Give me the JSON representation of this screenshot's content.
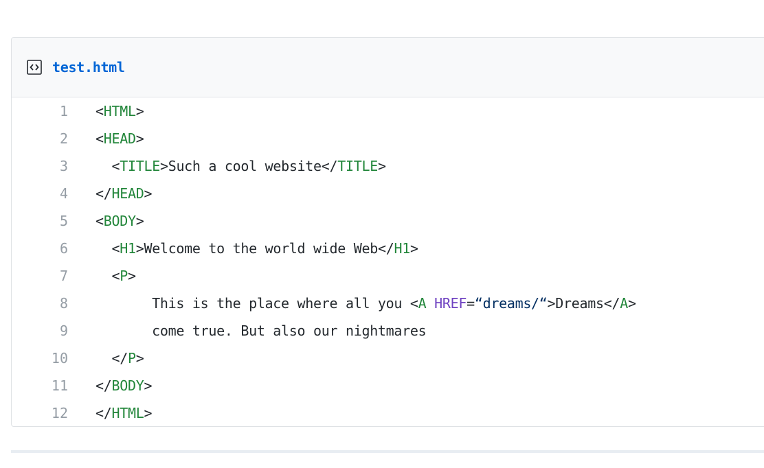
{
  "file": {
    "name": "test.html",
    "icon": "file-code-icon"
  },
  "colors": {
    "tag": "#22863a",
    "attribute": "#6f42c1",
    "string": "#032f62",
    "text": "#24292e",
    "link": "#0366d6",
    "line_number": "#959da5"
  },
  "lines": [
    {
      "number": "1",
      "tokens": [
        {
          "type": "punc",
          "text": "<"
        },
        {
          "type": "tag",
          "text": "HTML"
        },
        {
          "type": "punc",
          "text": ">"
        }
      ]
    },
    {
      "number": "2",
      "tokens": [
        {
          "type": "punc",
          "text": "<"
        },
        {
          "type": "tag",
          "text": "HEAD"
        },
        {
          "type": "punc",
          "text": ">"
        }
      ]
    },
    {
      "number": "3",
      "tokens": [
        {
          "type": "text",
          "text": "  "
        },
        {
          "type": "punc",
          "text": "<"
        },
        {
          "type": "tag",
          "text": "TITLE"
        },
        {
          "type": "punc",
          "text": ">"
        },
        {
          "type": "text",
          "text": "Such a cool website"
        },
        {
          "type": "punc",
          "text": "</"
        },
        {
          "type": "tag",
          "text": "TITLE"
        },
        {
          "type": "punc",
          "text": ">"
        }
      ]
    },
    {
      "number": "4",
      "tokens": [
        {
          "type": "punc",
          "text": "</"
        },
        {
          "type": "tag",
          "text": "HEAD"
        },
        {
          "type": "punc",
          "text": ">"
        }
      ]
    },
    {
      "number": "5",
      "tokens": [
        {
          "type": "punc",
          "text": "<"
        },
        {
          "type": "tag",
          "text": "BODY"
        },
        {
          "type": "punc",
          "text": ">"
        }
      ]
    },
    {
      "number": "6",
      "tokens": [
        {
          "type": "text",
          "text": "  "
        },
        {
          "type": "punc",
          "text": "<"
        },
        {
          "type": "tag",
          "text": "H1"
        },
        {
          "type": "punc",
          "text": ">"
        },
        {
          "type": "text",
          "text": "Welcome to the world wide Web"
        },
        {
          "type": "punc",
          "text": "</"
        },
        {
          "type": "tag",
          "text": "H1"
        },
        {
          "type": "punc",
          "text": ">"
        }
      ]
    },
    {
      "number": "7",
      "tokens": [
        {
          "type": "text",
          "text": "  "
        },
        {
          "type": "punc",
          "text": "<"
        },
        {
          "type": "tag",
          "text": "P"
        },
        {
          "type": "punc",
          "text": ">"
        }
      ]
    },
    {
      "number": "8",
      "tokens": [
        {
          "type": "text",
          "text": "       This is the place where all you "
        },
        {
          "type": "punc",
          "text": "<"
        },
        {
          "type": "tag",
          "text": "A"
        },
        {
          "type": "text",
          "text": " "
        },
        {
          "type": "attr",
          "text": "HREF"
        },
        {
          "type": "punc",
          "text": "="
        },
        {
          "type": "str",
          "text": "“dreams/“"
        },
        {
          "type": "punc",
          "text": ">"
        },
        {
          "type": "text",
          "text": "Dreams"
        },
        {
          "type": "punc",
          "text": "</"
        },
        {
          "type": "tag",
          "text": "A"
        },
        {
          "type": "punc",
          "text": ">"
        }
      ]
    },
    {
      "number": "9",
      "tokens": [
        {
          "type": "text",
          "text": "       come true. But also our nightmares"
        }
      ]
    },
    {
      "number": "10",
      "tokens": [
        {
          "type": "text",
          "text": "  "
        },
        {
          "type": "punc",
          "text": "</"
        },
        {
          "type": "tag",
          "text": "P"
        },
        {
          "type": "punc",
          "text": ">"
        }
      ]
    },
    {
      "number": "11",
      "tokens": [
        {
          "type": "punc",
          "text": "</"
        },
        {
          "type": "tag",
          "text": "BODY"
        },
        {
          "type": "punc",
          "text": ">"
        }
      ]
    },
    {
      "number": "12",
      "tokens": [
        {
          "type": "punc",
          "text": "</"
        },
        {
          "type": "tag",
          "text": "HTML"
        },
        {
          "type": "punc",
          "text": ">"
        }
      ]
    }
  ]
}
